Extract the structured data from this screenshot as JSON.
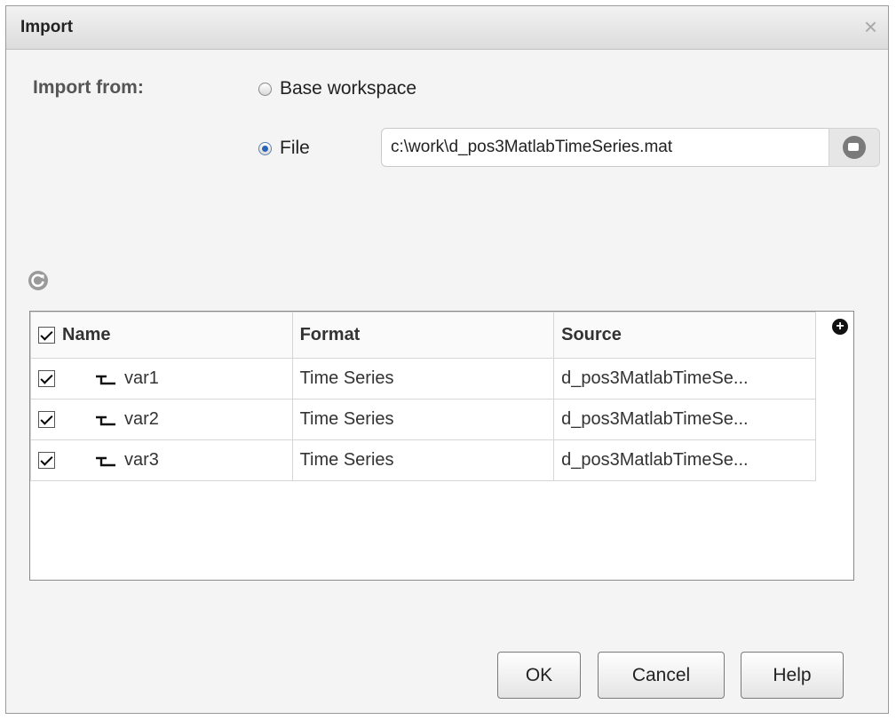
{
  "dialog": {
    "title": "Import",
    "close_glyph": "×"
  },
  "import_from": {
    "label": "Import from:",
    "options": [
      {
        "label": "Base workspace",
        "selected": false
      },
      {
        "label": "File",
        "selected": true
      }
    ],
    "file_path": "c:\\work\\d_pos3MatlabTimeSeries.mat",
    "browse_icon": "folder-browse-icon",
    "refresh_icon": "refresh-icon"
  },
  "table": {
    "columns": [
      "Name",
      "Format",
      "Source"
    ],
    "header_checked": true,
    "add_column_glyph": "+",
    "rows": [
      {
        "checked": true,
        "icon": "signal-icon",
        "name": "var1",
        "format": "Time Series",
        "source": "d_pos3MatlabTimeSe..."
      },
      {
        "checked": true,
        "icon": "signal-icon",
        "name": "var2",
        "format": "Time Series",
        "source": "d_pos3MatlabTimeSe..."
      },
      {
        "checked": true,
        "icon": "signal-icon",
        "name": "var3",
        "format": "Time Series",
        "source": "d_pos3MatlabTimeSe..."
      }
    ]
  },
  "buttons": {
    "ok": "OK",
    "cancel": "Cancel",
    "help": "Help"
  }
}
